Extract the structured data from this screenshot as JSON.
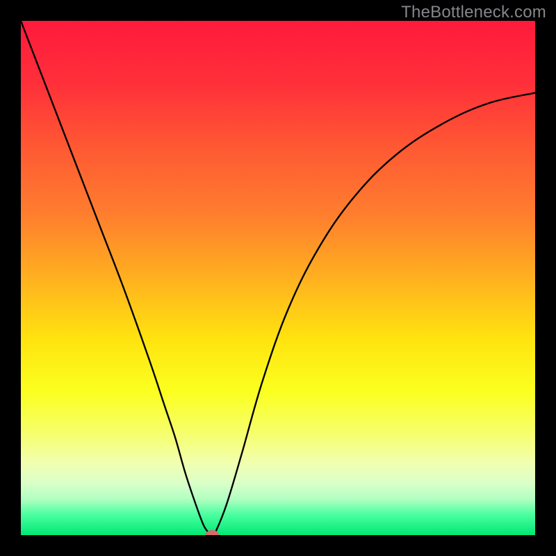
{
  "watermark": "TheBottleneck.com",
  "chart_data": {
    "type": "line",
    "title": "",
    "xlabel": "",
    "ylabel": "",
    "xlim": [
      0,
      1
    ],
    "ylim": [
      0,
      1
    ],
    "grid": false,
    "legend": false,
    "gradient_stops": [
      {
        "offset": 0.0,
        "color": "#ff1a3c"
      },
      {
        "offset": 0.12,
        "color": "#ff2f3a"
      },
      {
        "offset": 0.25,
        "color": "#ff5a33"
      },
      {
        "offset": 0.38,
        "color": "#ff7f2e"
      },
      {
        "offset": 0.5,
        "color": "#ffb01f"
      },
      {
        "offset": 0.62,
        "color": "#ffe40f"
      },
      {
        "offset": 0.72,
        "color": "#fbff1f"
      },
      {
        "offset": 0.8,
        "color": "#f6ff6a"
      },
      {
        "offset": 0.86,
        "color": "#f1ffb0"
      },
      {
        "offset": 0.9,
        "color": "#d9ffc9"
      },
      {
        "offset": 0.93,
        "color": "#b0ffc1"
      },
      {
        "offset": 0.96,
        "color": "#4affa0"
      },
      {
        "offset": 1.0,
        "color": "#00e874"
      }
    ],
    "series": [
      {
        "name": "bottleneck-curve",
        "x": [
          0.0,
          0.05,
          0.1,
          0.15,
          0.2,
          0.25,
          0.28,
          0.3,
          0.32,
          0.34,
          0.355,
          0.365,
          0.372,
          0.378,
          0.4,
          0.43,
          0.47,
          0.52,
          0.58,
          0.65,
          0.73,
          0.82,
          0.91,
          1.0
        ],
        "y": [
          1.0,
          0.87,
          0.74,
          0.61,
          0.48,
          0.34,
          0.25,
          0.19,
          0.12,
          0.06,
          0.02,
          0.005,
          0.0,
          0.005,
          0.06,
          0.16,
          0.3,
          0.44,
          0.56,
          0.66,
          0.74,
          0.8,
          0.84,
          0.86
        ]
      }
    ],
    "marker": {
      "name": "minimum-point",
      "x": 0.372,
      "y": 0.0,
      "rx": 0.013,
      "ry": 0.01,
      "color": "#d76a6a"
    }
  }
}
